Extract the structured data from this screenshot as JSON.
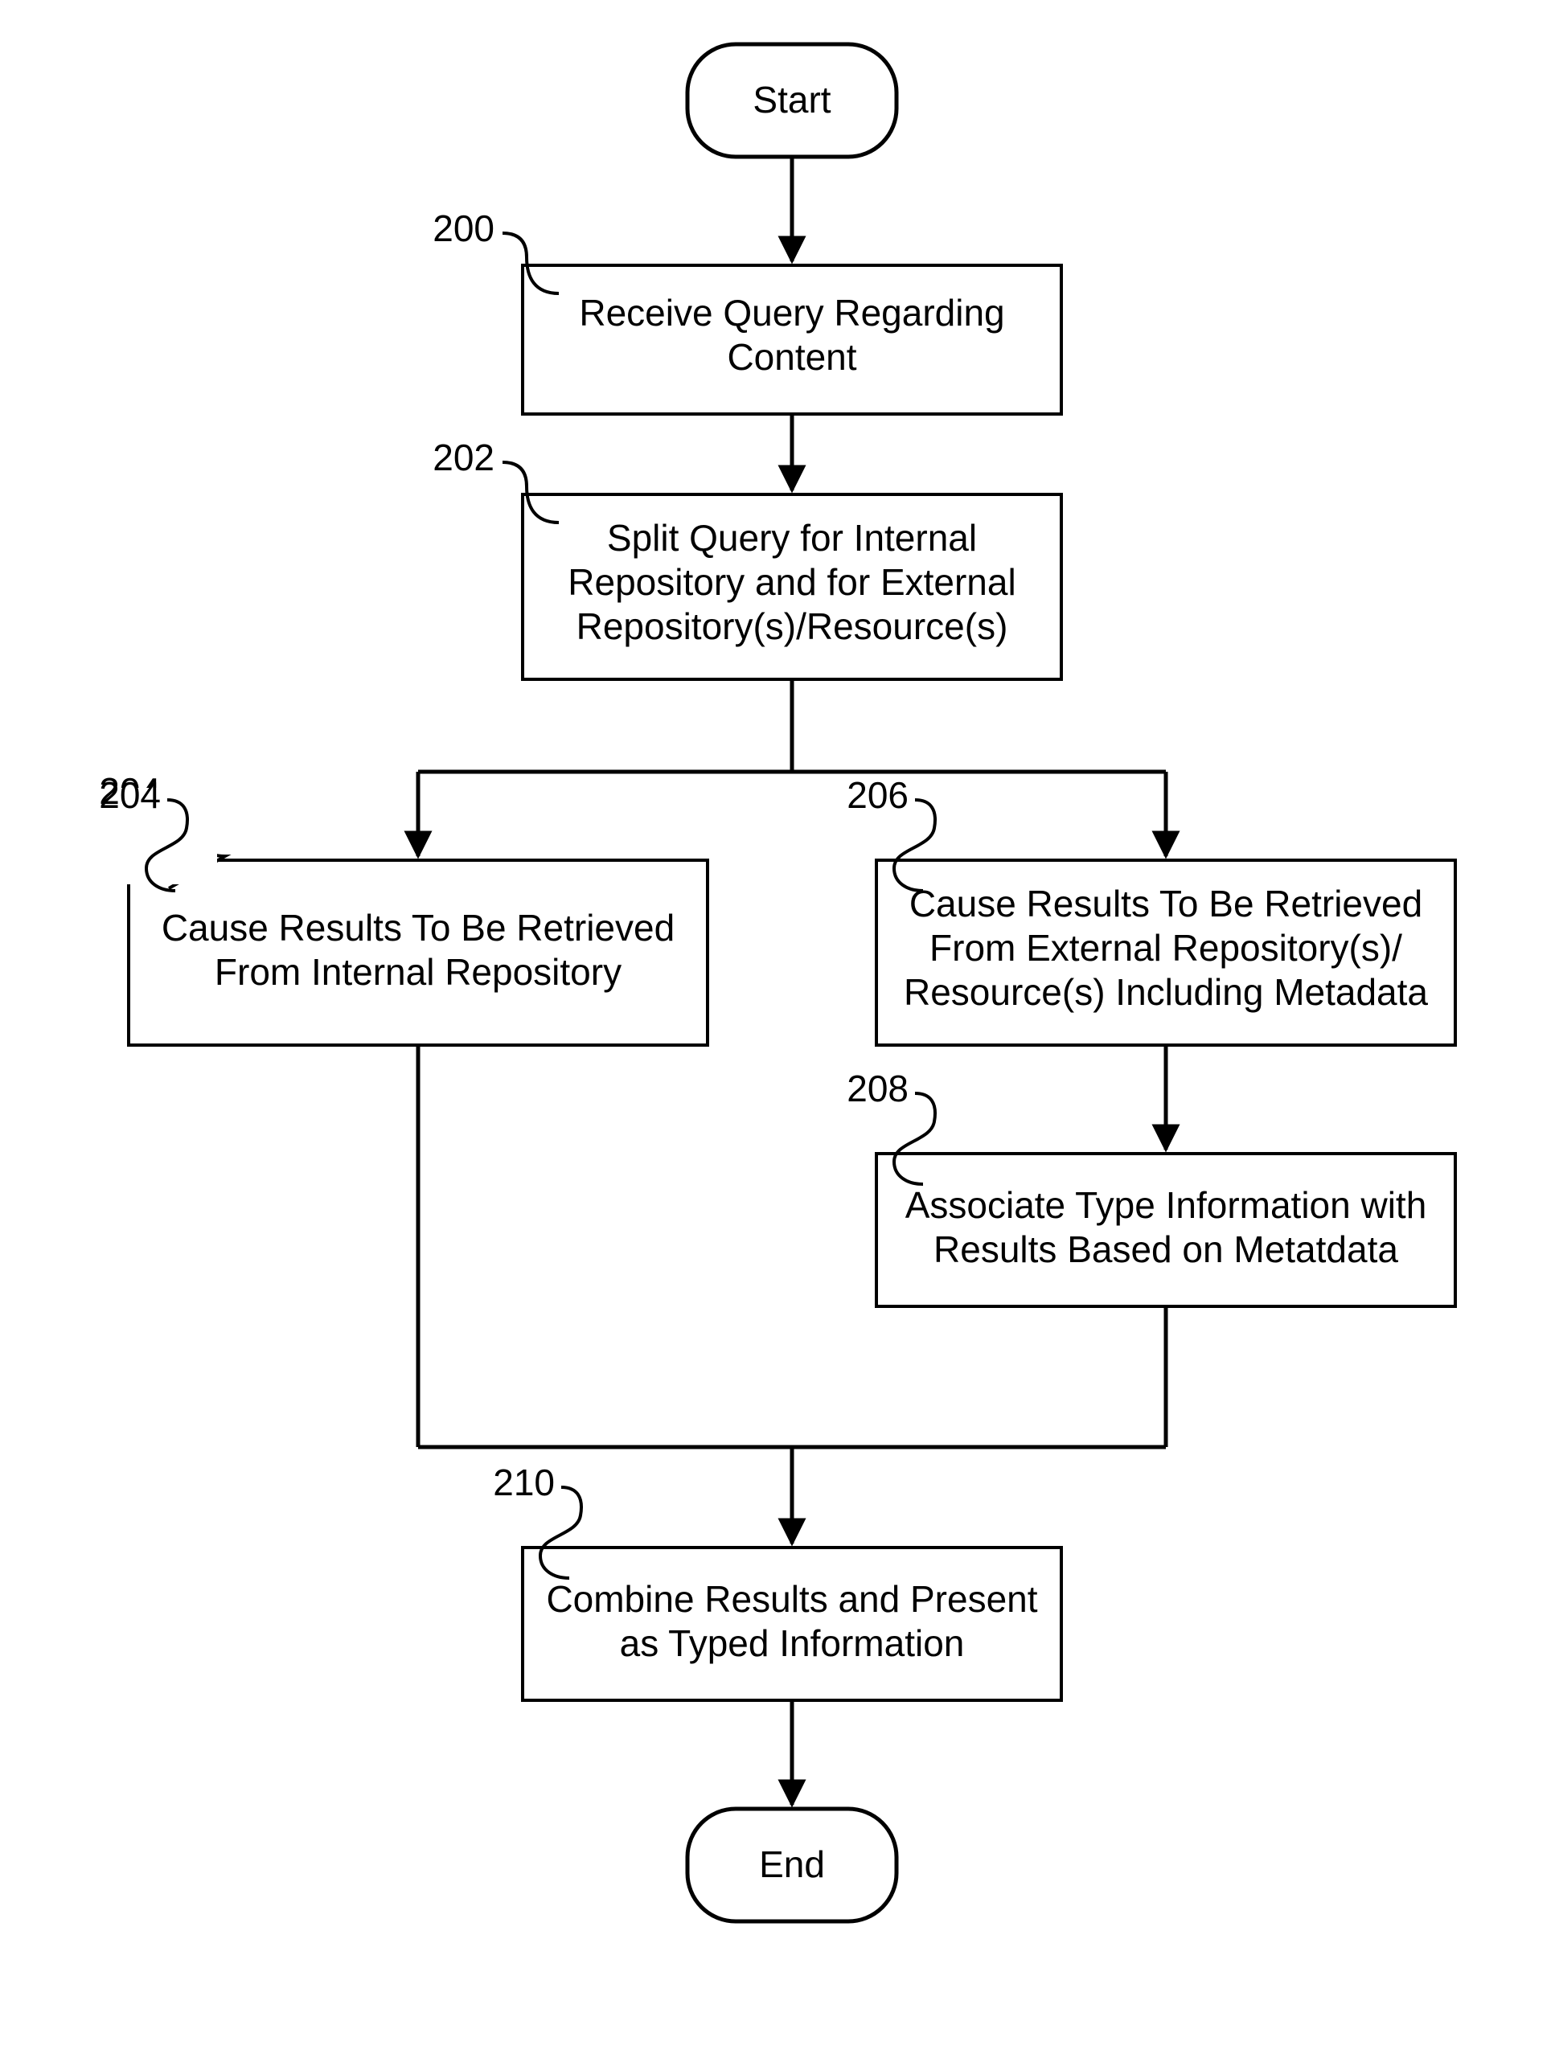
{
  "nodes": {
    "start": {
      "label": "Start"
    },
    "end": {
      "label": "End"
    },
    "n200": {
      "ref": "200",
      "lines": [
        "Receive Query Regarding",
        "Content"
      ]
    },
    "n202": {
      "ref": "202",
      "lines": [
        "Split Query for Internal",
        "Repository and for External",
        "Repository(s)/Resource(s)"
      ]
    },
    "n204": {
      "ref": "204",
      "lines": [
        "Cause Results To Be Retrieved",
        "From Internal Repository"
      ]
    },
    "n206": {
      "ref": "206",
      "lines": [
        "Cause Results To Be Retrieved",
        "From External Repository(s)/",
        "Resource(s) Including Metadata"
      ]
    },
    "n208": {
      "ref": "208",
      "lines": [
        "Associate Type Information with",
        "Results Based on Metatdata"
      ]
    },
    "n210": {
      "ref": "210",
      "lines": [
        "Combine Results and Present",
        "as Typed Information"
      ]
    }
  }
}
